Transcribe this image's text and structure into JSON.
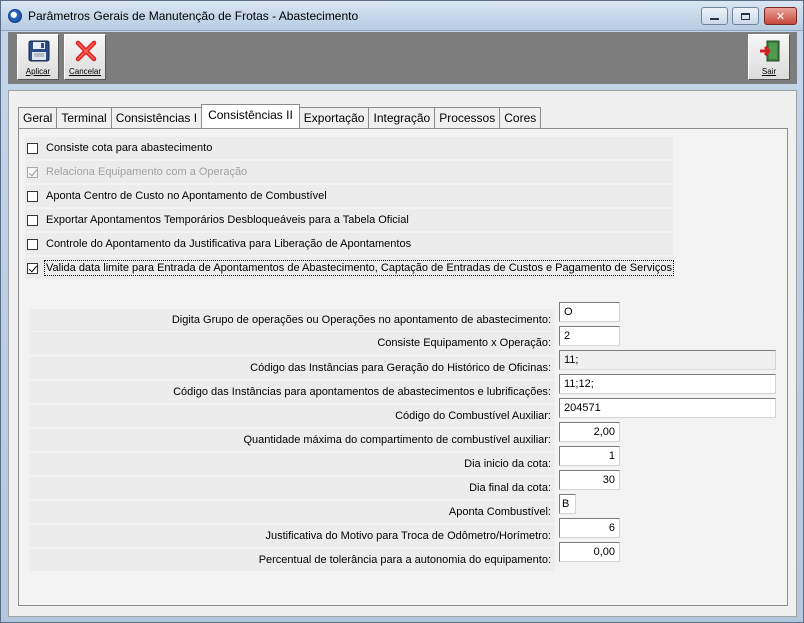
{
  "window": {
    "title": "Parâmetros Gerais de Manutenção de Frotas - Abastecimento",
    "min_glyph": "▭",
    "max_glyph": "▢",
    "close_glyph": "✕"
  },
  "toolbar": {
    "apply_label": "Aplicar",
    "cancel_label": "Cancelar",
    "exit_label": "Sair",
    "apply_icon": "floppy-disk-icon",
    "cancel_icon": "red-x-icon",
    "exit_icon": "exit-door-icon"
  },
  "tabs": [
    {
      "label": "Geral"
    },
    {
      "label": "Terminal"
    },
    {
      "label": "Consistências I"
    },
    {
      "label": "Consistências II"
    },
    {
      "label": "Exportação"
    },
    {
      "label": "Integração"
    },
    {
      "label": "Processos"
    },
    {
      "label": "Cores"
    }
  ],
  "active_tab": "Consistências II",
  "checkboxes": [
    {
      "label": "Consiste cota para abastecimento",
      "checked": false,
      "disabled": false
    },
    {
      "label": "Relaciona Equipamento com a Operação",
      "checked": true,
      "disabled": true
    },
    {
      "label": "Aponta Centro de Custo no Apontamento de Combustível",
      "checked": false,
      "disabled": false
    },
    {
      "label": "Exportar Apontamentos Temporários Desbloqueáveis para a Tabela Oficial",
      "checked": false,
      "disabled": false
    },
    {
      "label": "Controle do Apontamento da Justificativa para Liberação de Apontamentos",
      "checked": false,
      "disabled": false
    },
    {
      "label": "Valida data limite para Entrada de Apontamentos de Abastecimento, Captação de Entradas de Custos e Pagamento de Serviços",
      "checked": true,
      "disabled": false
    }
  ],
  "fields": [
    {
      "label": "Digita Grupo de operações ou Operações no apontamento de abastecimento:",
      "value": "O"
    },
    {
      "label": "Consiste Equipamento x Operação:",
      "value": "2"
    },
    {
      "label": "Código das Instâncias para Geração do Histórico de Oficinas:",
      "value": "11;"
    },
    {
      "label": "Código das Instâncias para apontamentos de abastecimentos e lubrificações:",
      "value": "11;12;"
    },
    {
      "label": "Código do Combustível Auxiliar:",
      "value": "204571"
    },
    {
      "label": "Quantidade máxima do compartimento de combustível auxiliar:",
      "value": "2,00"
    },
    {
      "label": "Dia inicio da cota:",
      "value": "1"
    },
    {
      "label": "Dia final da cota:",
      "value": "30"
    },
    {
      "label": "Aponta Combustível:",
      "value": "B"
    },
    {
      "label": "Justificativa do Motivo para Troca de Odômetro/Horímetro:",
      "value": "6"
    },
    {
      "label": "Percentual de tolerância para a autonomia do equipamento:",
      "value": "0,00"
    }
  ]
}
